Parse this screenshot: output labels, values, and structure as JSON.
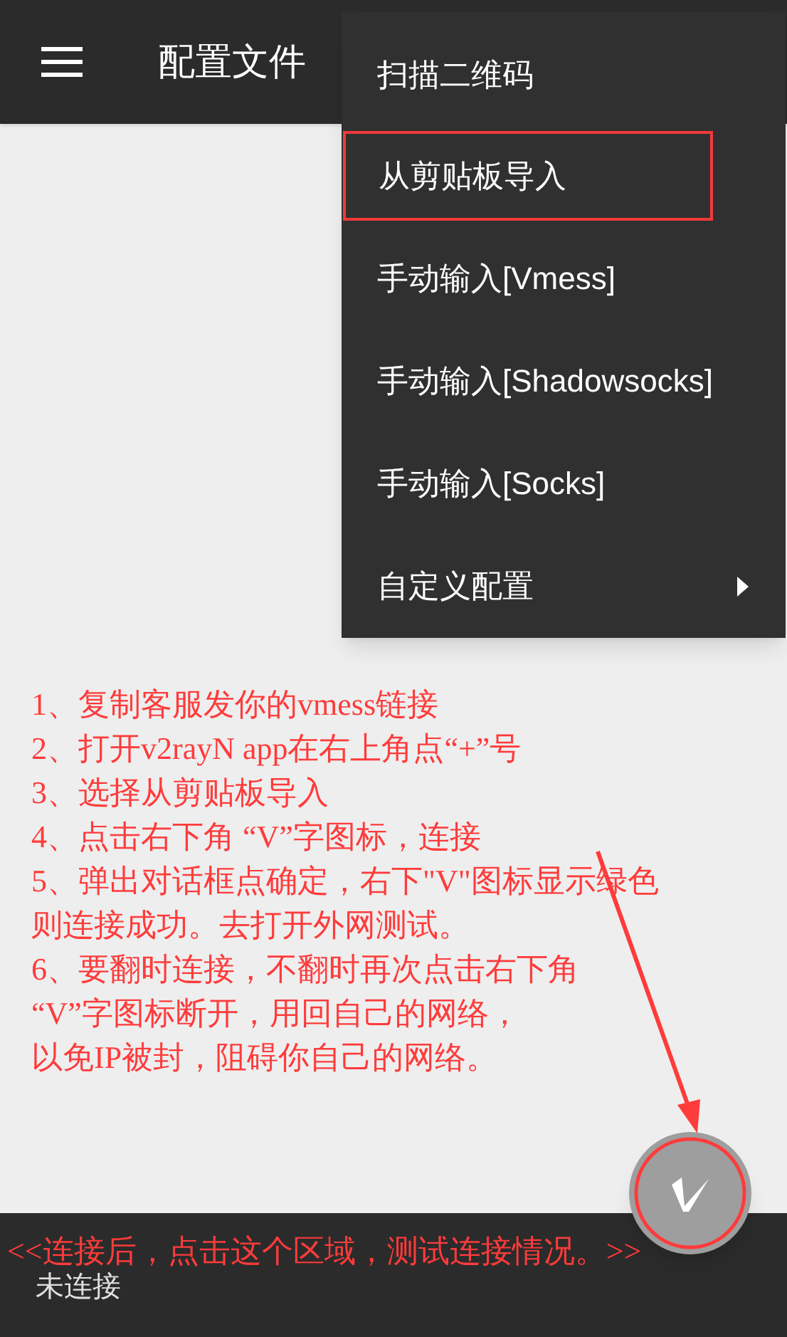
{
  "app_bar": {
    "title": "配置文件"
  },
  "menu": [
    {
      "label": "扫描二维码",
      "marked": false,
      "kind": "plain"
    },
    {
      "label": "从剪贴板导入",
      "marked": true,
      "kind": "plain"
    },
    {
      "label": "手动输入[Vmess]",
      "marked": false,
      "kind": "plain"
    },
    {
      "label": "手动输入[Shadowsocks]",
      "marked": false,
      "kind": "plain"
    },
    {
      "label": "手动输入[Socks]",
      "marked": false,
      "kind": "plain"
    },
    {
      "label": "自定义配置",
      "marked": false,
      "kind": "submenu"
    }
  ],
  "instructions": [
    "1、复制客服发你的vmess链接",
    "2、打开v2rayN app在右上角点“+”号",
    "3、选择从剪贴板导入",
    "4、点击右下角 “V”字图标，连接",
    "5、弹出对话框点确定，右下\"V\"图标显示绿色",
    "则连接成功。去打开外网测试。",
    "6、要翻时连接，不翻时再次点击右下角",
    "“V”字图标断开，用回自己的网络，",
    "以免IP被封，阻碍你自己的网络。"
  ],
  "bottom_note": "<<连接后，点击这个区域，测试连接情况。>>",
  "status": "未连接"
}
